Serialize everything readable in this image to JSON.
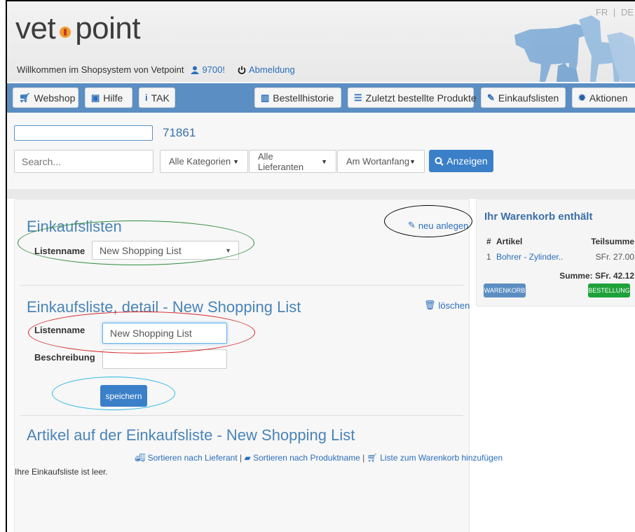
{
  "header": {
    "logo_left": "vet",
    "logo_right": "point",
    "lang_fr": "FR",
    "lang_sep": "|",
    "lang_de": "DE",
    "welcome_text": "Willkommen im Shopsystem von Vetpoint",
    "user_id": "9700!",
    "logout_label": "Abmeldung"
  },
  "nav": {
    "webshop": "Webshop",
    "hilfe": "Hilfe",
    "tak": "TAK",
    "bestellhistorie": "Bestellhistorie",
    "zuletzt": "Zuletzt bestellte Produkte",
    "einkaufslisten": "Einkaufslisten",
    "aktionen": "Aktionen"
  },
  "search": {
    "code_value": "71861",
    "placeholder": "Search...",
    "kategorie": "Alle Kategorien",
    "lieferant": "Alle Lieferanten",
    "modus": "Am Wortanfang",
    "anzeigen": "Anzeigen"
  },
  "lists": {
    "title": "Einkaufslisten",
    "new_label": "neu anlegen",
    "listenname_label": "Listenname",
    "selected_list": "New Shopping List"
  },
  "detail": {
    "title": "Einkaufsliste, detail - New Shopping List",
    "delete_label": "löschen",
    "listenname_label": "Listenname",
    "listenname_value": "New Shopping List",
    "beschreibung_label": "Beschreibung",
    "beschreibung_value": "",
    "save_label": "speichern"
  },
  "articles": {
    "title": "Artikel auf der Einkaufsliste - New Shopping List",
    "sort_supplier": "Sortieren nach Lieferant",
    "sort_product": "Sortieren nach Produktname",
    "add_to_cart": "Liste zum Warenkorb hinzufügen",
    "empty_text": "Ihre Einkaufsliste ist leer."
  },
  "cart": {
    "title": "Ihr Warenkorb enthält",
    "col_num": "#",
    "col_article": "Artikel",
    "col_subtotal": "Teilsumme",
    "rows": [
      {
        "num": "1",
        "article": "Bohrer - Zylinder..",
        "subtotal": "SFr. 27.00"
      }
    ],
    "sum_label": "Summe: SFr. 42.12",
    "warenkorb_btn": "WARENKORB",
    "bestellung_btn": "BESTELLUNG"
  },
  "colors": {
    "nav_bar": "#5b8ec2",
    "primary_button": "#3a7fc8",
    "title_blue": "#4a84b8",
    "success_green": "#1fa13a",
    "annotation_green": "#2e8b3e",
    "annotation_red": "#d62020",
    "annotation_cyan": "#2ab7e6",
    "annotation_black": "#000000"
  }
}
